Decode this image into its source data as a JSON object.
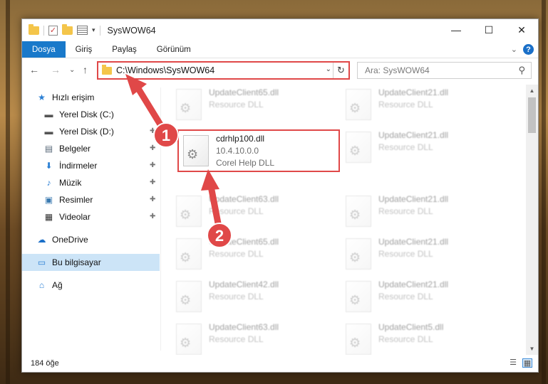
{
  "window": {
    "title": "SysWOW64",
    "minimize_glyph": "—",
    "maximize_glyph": "☐",
    "close_glyph": "✕"
  },
  "ribbon": {
    "tabs": [
      "Dosya",
      "Giriş",
      "Paylaş",
      "Görünüm"
    ],
    "collapse_glyph": "⌄",
    "help_glyph": "?"
  },
  "nav_buttons": {
    "back": "←",
    "forward": "→",
    "recent": "⌄",
    "up": "↑"
  },
  "address": {
    "path": "C:\\Windows\\SysWOW64",
    "dropdown_glyph": "⌄",
    "refresh_glyph": "↻"
  },
  "search": {
    "placeholder": "Ara: SysWOW64",
    "icon": "search-icon"
  },
  "sidebar": {
    "items": [
      {
        "label": "Hızlı erişim",
        "icon": "star-icon",
        "pinned": false
      },
      {
        "label": "Yerel Disk (C:)",
        "icon": "drive-icon",
        "pinned": false
      },
      {
        "label": "Yerel Disk (D:)",
        "icon": "drive-icon",
        "pinned": true
      },
      {
        "label": "Belgeler",
        "icon": "documents-icon",
        "pinned": true
      },
      {
        "label": "İndirmeler",
        "icon": "download-icon",
        "pinned": true
      },
      {
        "label": "Müzik",
        "icon": "music-icon",
        "pinned": true
      },
      {
        "label": "Resimler",
        "icon": "pictures-icon",
        "pinned": true
      },
      {
        "label": "Videolar",
        "icon": "videos-icon",
        "pinned": true
      },
      {
        "label": "OneDrive",
        "icon": "cloud-icon",
        "pinned": false
      },
      {
        "label": "Bu bilgisayar",
        "icon": "computer-icon",
        "pinned": false,
        "selected": true
      },
      {
        "label": "Ağ",
        "icon": "network-icon",
        "pinned": false
      }
    ],
    "pin_glyph": "📌"
  },
  "files": {
    "left_column": [
      {
        "name": "UpdateClient65.dll",
        "desc": "Resource DLL"
      },
      {
        "name": "cdrhlp100.dll",
        "version": "10.4.10.0.0",
        "desc": "Corel Help DLL",
        "highlighted": true
      },
      {
        "name": "UpdateClient63.dll",
        "desc": "Resource DLL"
      },
      {
        "name": "UpdateClient65.dll",
        "desc": "Resource DLL"
      },
      {
        "name": "UpdateClient42.dll",
        "desc": "Resource DLL"
      },
      {
        "name": "UpdateClient63.dll",
        "desc": "Resource DLL"
      }
    ],
    "right_column": [
      {
        "name": "UpdateClient21.dll",
        "desc": "Resource DLL"
      },
      {
        "name": "UpdateClient21.dll",
        "desc": "Resource DLL"
      },
      {
        "name": "UpdateClient21.dll",
        "desc": "Resource DLL"
      },
      {
        "name": "UpdateClient21.dll",
        "desc": "Resource DLL"
      },
      {
        "name": "UpdateClient21.dll",
        "desc": "Resource DLL"
      },
      {
        "name": "UpdateClient5.dll",
        "desc": "Resource DLL"
      }
    ]
  },
  "status": {
    "item_count": "184 öğe"
  },
  "annotations": [
    {
      "number": "1",
      "color": "#e04848"
    },
    {
      "number": "2",
      "color": "#e04848"
    }
  ]
}
